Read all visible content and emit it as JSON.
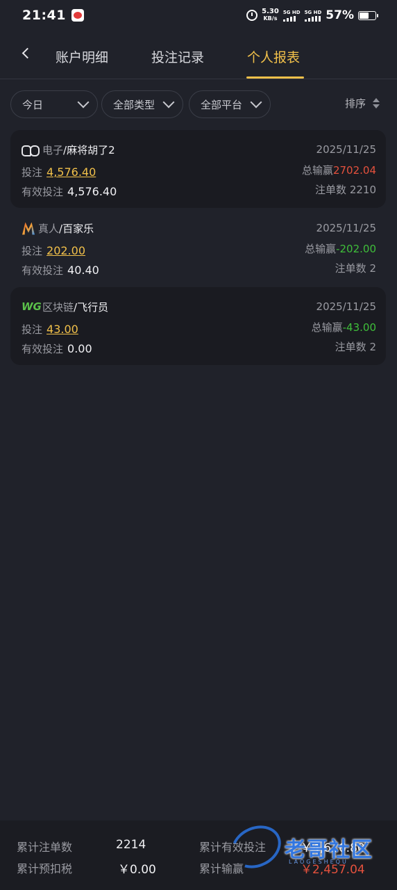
{
  "status_bar": {
    "time": "21:41",
    "net_speed_value": "5.30",
    "net_speed_unit": "KB/s",
    "sim1_label": "5G HD",
    "sim2_label": "5G HD",
    "battery_percent": "57%",
    "battery_level": 0.57
  },
  "header": {
    "tabs": [
      {
        "label": "账户明细",
        "active": false
      },
      {
        "label": "投注记录",
        "active": false
      },
      {
        "label": "个人报表",
        "active": true
      }
    ]
  },
  "filters": {
    "date": "今日",
    "type": "全部类型",
    "platform": "全部平台",
    "sort_label": "排序"
  },
  "records": [
    {
      "provider_icon": "pg-logo-icon",
      "category": "电子",
      "game": "/麻将胡了2",
      "date": "2025/11/25",
      "bet_label": "投注",
      "bet_value": "4,576.40",
      "valid_label": "有效投注",
      "valid_value": "4,576.40",
      "winloss_label": "总输赢",
      "winloss_value": "2702.04",
      "winloss_color": "#e5513d",
      "count_label": "注单数",
      "count_value": "2210"
    },
    {
      "provider_icon": "ag-logo-icon",
      "category": "真人",
      "game": "/百家乐",
      "date": "2025/11/25",
      "bet_label": "投注",
      "bet_value": "202.00",
      "valid_label": "有效投注",
      "valid_value": "40.40",
      "winloss_label": "总输赢",
      "winloss_value": "-202.00",
      "winloss_color": "#3fbf3a",
      "count_label": "注单数",
      "count_value": "2"
    },
    {
      "provider_icon": "wg-logo-icon",
      "category": "区块链",
      "game": "/飞行员",
      "date": "2025/11/25",
      "bet_label": "投注",
      "bet_value": "43.00",
      "valid_label": "有效投注",
      "valid_value": "0.00",
      "winloss_label": "总输赢",
      "winloss_value": "-43.00",
      "winloss_color": "#3fbf3a",
      "count_label": "注单数",
      "count_value": "2"
    }
  ],
  "summary": {
    "total_count_label": "累计注单数",
    "total_count_value": "2214",
    "tax_label": "累计预扣税",
    "tax_value": "￥0.00",
    "valid_total_label": "累计有效投注",
    "valid_total_value": "￥4,616.80",
    "winloss_total_label": "累计输赢",
    "winloss_total_value": "￥2,457.04"
  },
  "watermark": {
    "text": "老哥社区",
    "sub": "LAOGESHEQU"
  },
  "colors": {
    "accent": "#f1c04a",
    "loss_red": "#e5513d",
    "win_green": "#3fbf3a",
    "background": "#20222a"
  }
}
